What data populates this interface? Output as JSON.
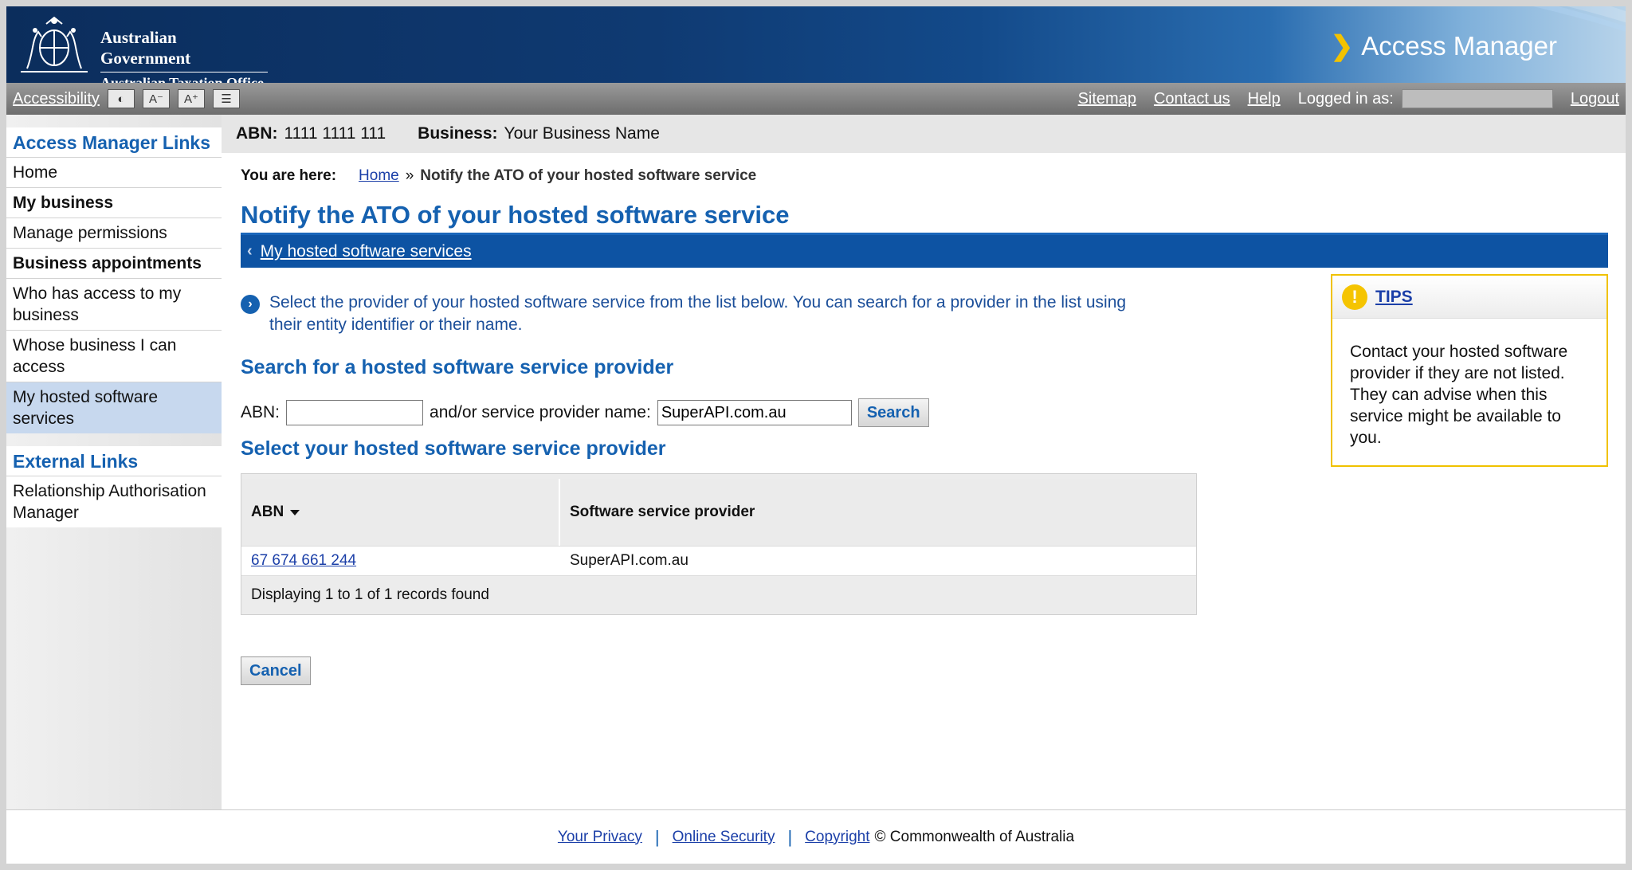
{
  "header": {
    "gov_line1": "Australian Government",
    "gov_line2": "Australian Taxation Office",
    "app_title": "Access Manager"
  },
  "toolbar": {
    "accessibility": "Accessibility",
    "btn_contrast": "◐",
    "btn_font_down": "A⁻",
    "btn_font_up": "A⁺",
    "btn_layout": "☰",
    "sitemap": "Sitemap",
    "contact": "Contact us",
    "help": "Help",
    "logged_in": "Logged in as:",
    "logout": "Logout"
  },
  "sidebar": {
    "section1_title": "Access Manager Links",
    "items": [
      {
        "label": "Home"
      },
      {
        "label": "My business"
      },
      {
        "label": "Manage permissions"
      },
      {
        "label": "Business appointments"
      },
      {
        "label": "Who has access to my business"
      },
      {
        "label": "Whose business I can access"
      },
      {
        "label": "My hosted software services"
      }
    ],
    "section2_title": "External Links",
    "external_items": [
      {
        "label": "Relationship Authorisation Manager"
      }
    ]
  },
  "business": {
    "abn_label": "ABN:",
    "abn_value": "1111 1111 111",
    "business_label": "Business:",
    "business_value": "Your Business Name"
  },
  "breadcrumb": {
    "prefix": "You are here:",
    "home": "Home",
    "sep": "»",
    "current": "Notify the ATO of your hosted software service"
  },
  "page": {
    "title": "Notify the ATO of your hosted software service",
    "back_link": "My hosted software services",
    "info_text": "Select the provider of your hosted software service from the list below. You can search for a provider in the list using their entity identifier or their name.",
    "search_heading": "Search for a hosted software service provider",
    "abn_field_label": "ABN:",
    "name_field_label": "and/or service provider name:",
    "abn_input_value": "",
    "name_input_value": "SuperAPI.com.au",
    "search_button": "Search",
    "select_heading": "Select your hosted software service provider",
    "cancel_button": "Cancel"
  },
  "table": {
    "columns": [
      "ABN",
      "Software service provider"
    ],
    "rows": [
      {
        "abn": "67 674 661 244",
        "provider": "SuperAPI.com.au"
      }
    ],
    "footer": "Displaying 1 to 1 of 1 records found"
  },
  "tips": {
    "title": "TIPS",
    "icon": "!",
    "body": "Contact your hosted software provider if they are not listed. They can advise when this service might be available to you."
  },
  "footer": {
    "privacy": "Your Privacy",
    "security": "Online Security",
    "copyright": "Copyright",
    "copyright_text": "© Commonwealth of Australia",
    "sep": "|"
  },
  "colors": {
    "brand_blue": "#1561b0",
    "header_dark": "#0b2d5c",
    "tips_border": "#f0c200"
  }
}
